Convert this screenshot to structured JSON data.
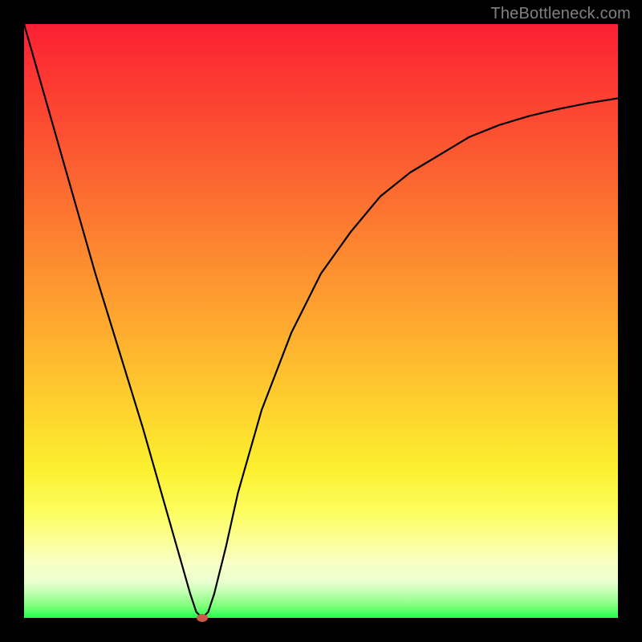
{
  "attribution": "TheBottleneck.com",
  "chart_data": {
    "type": "line",
    "title": "",
    "xlabel": "",
    "ylabel": "",
    "xlim": [
      0,
      100
    ],
    "ylim": [
      0,
      100
    ],
    "grid": false,
    "legend": false,
    "background_gradient": [
      "#fb2033",
      "#fed32e",
      "#fcff98",
      "#1fff4d"
    ],
    "series": [
      {
        "name": "bottleneck-curve",
        "x": [
          0,
          4,
          8,
          12,
          16,
          20,
          24,
          26,
          28,
          29,
          30,
          31,
          32,
          34,
          36,
          40,
          45,
          50,
          55,
          60,
          65,
          70,
          75,
          80,
          85,
          90,
          95,
          100
        ],
        "y": [
          100,
          86,
          72,
          58,
          45,
          32,
          18,
          11,
          4,
          1,
          0,
          1,
          4,
          12,
          21,
          35,
          48,
          58,
          65,
          71,
          75,
          78,
          81,
          83,
          84.5,
          85.7,
          86.7,
          87.5
        ]
      }
    ],
    "marker": {
      "x": 30,
      "y": 0,
      "color": "#c95a4a"
    }
  }
}
